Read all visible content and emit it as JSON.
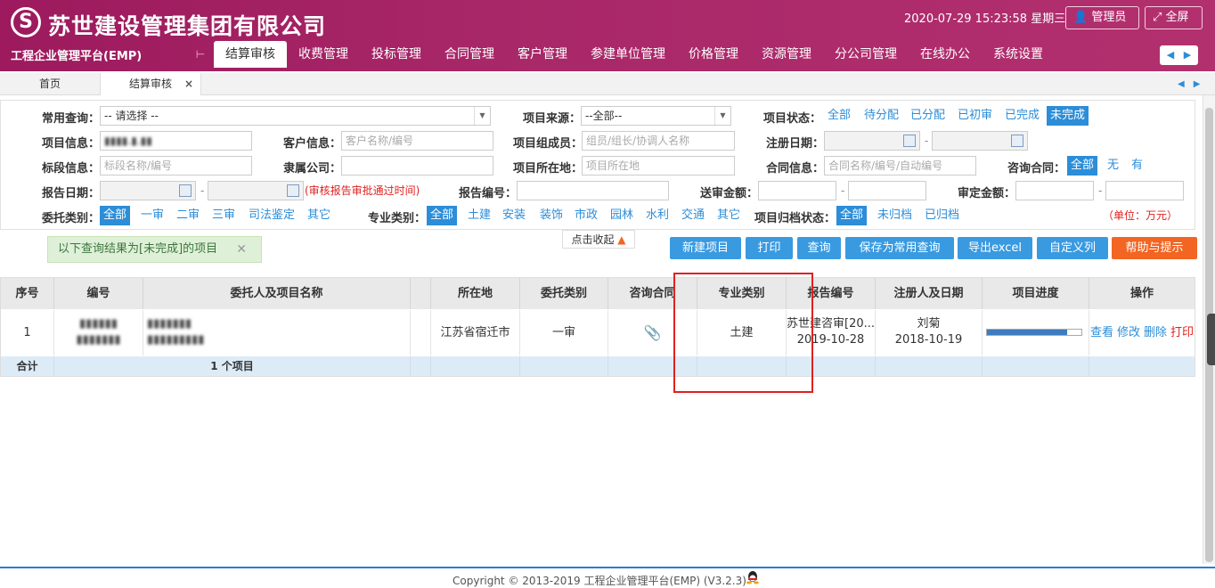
{
  "header": {
    "company": "苏世建设管理集团有限公司",
    "platform": "工程企业管理平台(EMP)",
    "datetime": "2020-07-29 15:23:58 星期三",
    "admin_label": "管理员",
    "fullscreen_label": "全屏",
    "logo_glyph": "S"
  },
  "nav": {
    "items": [
      "结算审核",
      "收费管理",
      "投标管理",
      "合同管理",
      "客户管理",
      "参建单位管理",
      "价格管理",
      "资源管理",
      "分公司管理",
      "在线办公",
      "系统设置"
    ],
    "separator": "⊢"
  },
  "tabs": {
    "home": "首页",
    "current": "结算审核",
    "close": "×"
  },
  "filters": {
    "common_query": {
      "label": "常用查询：",
      "value": "-- 请选择 --"
    },
    "source": {
      "label": "项目来源：",
      "value": "--全部--"
    },
    "status": {
      "label": "项目状态：",
      "options": [
        "全部",
        "待分配",
        "已分配",
        "已初审",
        "已完成",
        "未完成"
      ],
      "selected": "未完成"
    },
    "project_info": {
      "label": "项目信息：",
      "value": "▮▮▮▮.▮.▮▮"
    },
    "client_info": {
      "label": "客户信息：",
      "placeholder": "客户名称/编号"
    },
    "members": {
      "label": "项目组成员：",
      "placeholder": "组员/组长/协调人名称"
    },
    "register_date": {
      "label": "注册日期："
    },
    "section_info": {
      "label": "标段信息：",
      "placeholder": "标段名称/编号"
    },
    "company": {
      "label": "隶属公司："
    },
    "location": {
      "label": "项目所在地：",
      "placeholder": "项目所在地"
    },
    "contract_info": {
      "label": "合同信息：",
      "placeholder": "合同名称/编号/自动编号"
    },
    "consult_contract": {
      "label": "咨询合同：",
      "options": [
        "全部",
        "无",
        "有"
      ],
      "selected": "全部"
    },
    "report_date": {
      "label": "报告日期：",
      "hint": "(审核报告审批通过时间)"
    },
    "report_no": {
      "label": "报告编号："
    },
    "submit_amount": {
      "label": "送审金额："
    },
    "approved_amount": {
      "label": "审定金额："
    },
    "entrust_type": {
      "label": "委托类别：",
      "options": [
        "全部",
        "一审",
        "二审",
        "三审",
        "司法鉴定",
        "其它"
      ],
      "selected": "全部"
    },
    "profession": {
      "label": "专业类别：",
      "options": [
        "全部",
        "土建",
        "安装",
        "装饰",
        "市政",
        "园林",
        "水利",
        "交通",
        "其它"
      ],
      "selected": "全部"
    },
    "archive_status": {
      "label": "项目归档状态：",
      "options": [
        "全部",
        "未归档",
        "已归档"
      ],
      "selected": "全部"
    },
    "unit": "（单位：万元）",
    "dash": "-"
  },
  "collapse_label": "点击收起",
  "notice": "以下查询结果为[未完成]的项目",
  "actions": {
    "new": "新建项目",
    "print": "打印",
    "query": "查询",
    "save": "保存为常用查询",
    "export": "导出excel",
    "custom": "自定义列",
    "help": "帮助与提示"
  },
  "table": {
    "headers": [
      "序号",
      "编号",
      "委托人及项目名称",
      "所在地",
      "委托类别",
      "咨询合同",
      "专业类别",
      "报告编号",
      "注册人及日期",
      "项目进度",
      "操作"
    ],
    "rows": [
      {
        "index": "1",
        "code_line1": "▮▮▮▮▮▮",
        "code_line2": "▮▮▮▮▮▮▮",
        "name_line1": "▮▮▮▮▮▮▮",
        "name_line2": "▮▮▮▮▮▮▮▮▮",
        "location": "江苏省宿迁市",
        "entrust_type": "一审",
        "profession": "土建",
        "report_no": "苏世建咨审[20...",
        "report_date": "2019-10-28",
        "registrant": "刘菊",
        "register_date": "2018-10-19",
        "progress": 0.85,
        "ops": [
          "查看",
          "修改",
          "删除",
          "打印"
        ]
      }
    ],
    "footer": {
      "label": "合计",
      "count": "1 个项目"
    }
  },
  "footer": {
    "copyright": "Copyright © 2013-2019 工程企业管理平台(EMP) (V3.2.3)"
  },
  "colors": {
    "brand": "#a82768",
    "accent": "#2c8dd8",
    "help": "#f26522",
    "highlight": "#e02020"
  },
  "icons": [
    "logo-icon",
    "user-icon",
    "fullscreen-icon",
    "calendar-icon",
    "paperclip-icon",
    "qq-icon",
    "arrow-up-icon"
  ]
}
